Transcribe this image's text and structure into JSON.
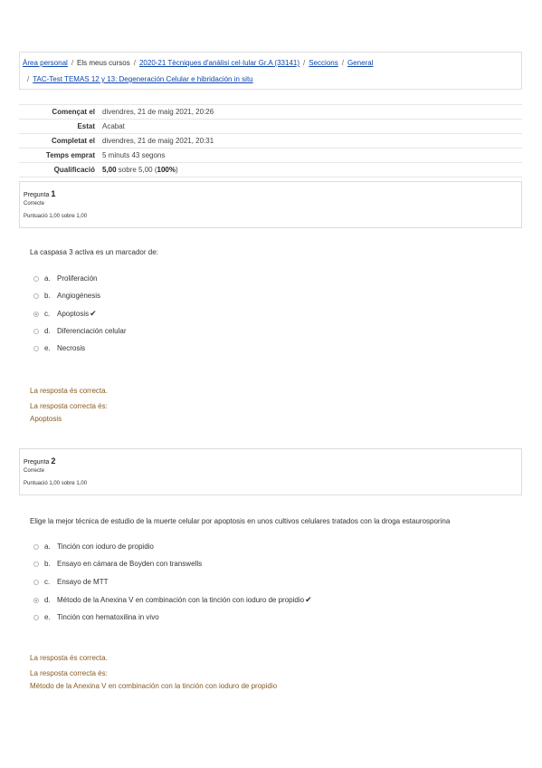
{
  "breadcrumb": {
    "items": [
      "Àrea personal",
      "Els meus cursos",
      "2020-21 Tècniques d'anàlisi cel·lular Gr.A (33141)",
      "Seccions",
      "General"
    ],
    "last": "TAC-Test TEMAS 12 y 13: Degeneración Celular e hibridación in situ",
    "separator": "/"
  },
  "summary": [
    {
      "label": "Començat el",
      "value": "divendres, 21 de maig 2021, 20:26"
    },
    {
      "label": "Estat",
      "value": "Acabat"
    },
    {
      "label": "Completat el",
      "value": "divendres, 21 de maig 2021, 20:31"
    },
    {
      "label": "Temps emprat",
      "value": "5 minuts 43 segons"
    },
    {
      "label": "Qualificació",
      "value_bold": "5,00",
      "value_mid": " sobre 5,00 (",
      "value_pct": "100%",
      "value_end": ")"
    }
  ],
  "questions": [
    {
      "label": "Pregunta",
      "number": "1",
      "status": "Correcte",
      "points": "Puntuació 1,00 sobre 1,00",
      "text": "La caspasa 3 activa es un marcador de:",
      "answers": [
        {
          "letter": "a.",
          "text": "Proliferación",
          "selected": false,
          "mark": ""
        },
        {
          "letter": "b.",
          "text": "Angiogénesis",
          "selected": false,
          "mark": ""
        },
        {
          "letter": "c.",
          "text": "Apoptosis",
          "selected": true,
          "mark": "✔"
        },
        {
          "letter": "d.",
          "text": "Diferenciación celular",
          "selected": false,
          "mark": ""
        },
        {
          "letter": "e.",
          "text": "Necrosis",
          "selected": false,
          "mark": ""
        }
      ],
      "feedback": "La resposta és correcta.",
      "correct_label": "La resposta correcta és:",
      "correct_answer": "Apoptosis"
    },
    {
      "label": "Pregunta",
      "number": "2",
      "status": "Correcte",
      "points": "Puntuació 1,00 sobre 1,00",
      "text": "Elige la mejor técnica de estudio de la muerte celular por apoptosis en unos cultivos celulares tratados con la droga estaurosporina",
      "answers": [
        {
          "letter": "a.",
          "text": "Tinción con ioduro de propidio",
          "selected": false,
          "mark": ""
        },
        {
          "letter": "b.",
          "text": "Ensayo en cámara de Boyden con transwells",
          "selected": false,
          "mark": ""
        },
        {
          "letter": "c.",
          "text": "Ensayo de MTT",
          "selected": false,
          "mark": ""
        },
        {
          "letter": "d.",
          "text": "Método de la Anexina V en combinación con la tinción con ioduro de propidio",
          "selected": true,
          "mark": "✔"
        },
        {
          "letter": "e.",
          "text": "Tinción con hematoxilina in vivo",
          "selected": false,
          "mark": ""
        }
      ],
      "feedback": "La resposta és correcta.",
      "correct_label": "La resposta correcta és:",
      "correct_answer": "Método de la Anexina V en combinación con la tinción con ioduro de propidio"
    }
  ]
}
